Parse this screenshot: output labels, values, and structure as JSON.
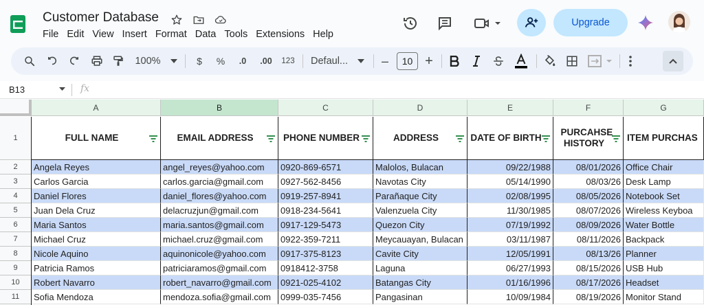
{
  "doc": {
    "title": "Customer Database"
  },
  "menu": [
    "File",
    "Edit",
    "View",
    "Insert",
    "Format",
    "Data",
    "Tools",
    "Extensions",
    "Help"
  ],
  "topbar": {
    "upgrade_label": "Upgrade"
  },
  "toolbar": {
    "zoom": "100%",
    "currency": "$",
    "percent": "%",
    "decrease_decimal": ".0",
    "increase_decimal": ".00",
    "number_format": "123",
    "font": "Defaul...",
    "font_size": "10",
    "minus": "–",
    "plus": "+"
  },
  "formula_bar": {
    "cell_ref": "B13",
    "fx": "fx"
  },
  "grid": {
    "columns": [
      "A",
      "B",
      "C",
      "D",
      "E",
      "F",
      "G"
    ],
    "headers": [
      "FULL NAME",
      "EMAIL ADDRESS",
      "PHONE NUMBER",
      "ADDRESS",
      "DATE OF BIRTH",
      "PURCAHSE HISTORY",
      "ITEM PURCHAS"
    ],
    "row_numbers": [
      "1",
      "2",
      "3",
      "4",
      "5",
      "6",
      "7",
      "8",
      "9",
      "10",
      "11"
    ],
    "rows": [
      [
        "Angela Reyes",
        "angel_reyes@yahoo.com",
        "0920-869-6571",
        "Malolos, Bulacan",
        "09/22/1988",
        "08/01/2026",
        "Office Chair"
      ],
      [
        "Carlos Garcia",
        "carlos.garcia@gmail.com",
        "0927-562-8456",
        "Navotas City",
        "05/14/1990",
        "08/03/26",
        "Desk Lamp"
      ],
      [
        "Daniel Flores",
        "daniel_flores@yahoo.com",
        "0919-257-8941",
        "Parañaque City",
        "02/08/1995",
        "08/05/2026",
        "Notebook Set"
      ],
      [
        "Juan Dela Cruz",
        "delacruzjun@gmail.com",
        "0918-234-5641",
        "Valenzuela City",
        "11/30/1985",
        "08/07/2026",
        "Wireless Keyboa"
      ],
      [
        "Maria Santos",
        "maria.santos@gmail.com",
        "0917-129-5473",
        "Quezon City",
        "07/19/1992",
        "08/09/2026",
        "Water Bottle"
      ],
      [
        "Michael Cruz",
        "michael.cruz@gmail.com",
        "0922-359-7211",
        "Meycauayan, Bulacan",
        "03/11/1987",
        "08/11/2026",
        "Backpack"
      ],
      [
        "Nicole Aquino",
        "aquinonicole@yahoo.com",
        "0917-375-8123",
        "Cavite City",
        "12/05/1991",
        "08/13/26",
        "Planner"
      ],
      [
        "Patricia Ramos",
        "patriciaramos@gmail.com",
        "0918412-3758",
        "Laguna",
        "06/27/1993",
        "08/15/2026",
        "USB Hub"
      ],
      [
        "Robert Navarro",
        "robert_navarro@gmail.com",
        "0921-025-4102",
        "Batangas City",
        "01/16/1996",
        "08/17/2026",
        "Headset"
      ],
      [
        "Sofia Mendoza",
        "mendoza.sofia@gmail.com",
        "0999-035-7456",
        "Pangasinan",
        "10/09/1984",
        "08/19/2026",
        "Monitor Stand"
      ]
    ]
  },
  "colors": {
    "band": "#c9daf8",
    "selected_col": "#d3e3fd",
    "accent": "#0b57d0"
  }
}
